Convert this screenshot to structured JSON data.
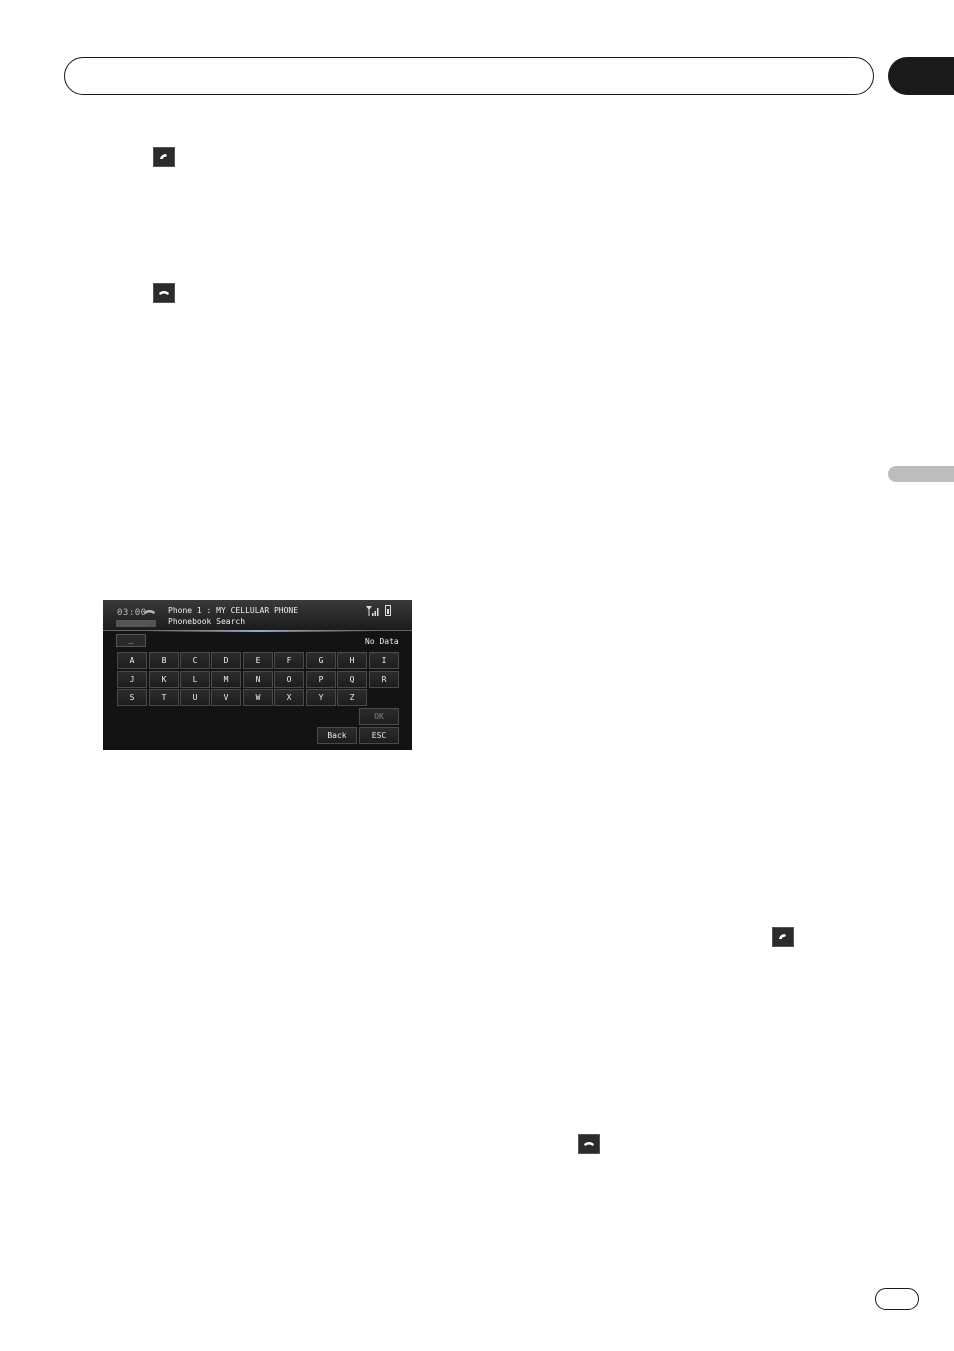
{
  "device_screen": {
    "clock": "03:00",
    "header_line1": "Phone 1 : MY CELLULAR PHONE",
    "header_line2": "Phonebook Search",
    "input_value": "_",
    "status": "No Data",
    "keys_row1": [
      "A",
      "B",
      "C",
      "D",
      "E",
      "F",
      "G",
      "H",
      "I"
    ],
    "keys_row2": [
      "J",
      "K",
      "L",
      "M",
      "N",
      "O",
      "P",
      "Q",
      "R"
    ],
    "keys_row3": [
      "S",
      "T",
      "U",
      "V",
      "W",
      "X",
      "Y",
      "Z"
    ],
    "ok_label": "OK",
    "back_label": "Back",
    "esc_label": "ESC"
  },
  "icons": {
    "off_hook": "phone-off-hook-icon",
    "on_hook": "phone-on-hook-icon"
  }
}
